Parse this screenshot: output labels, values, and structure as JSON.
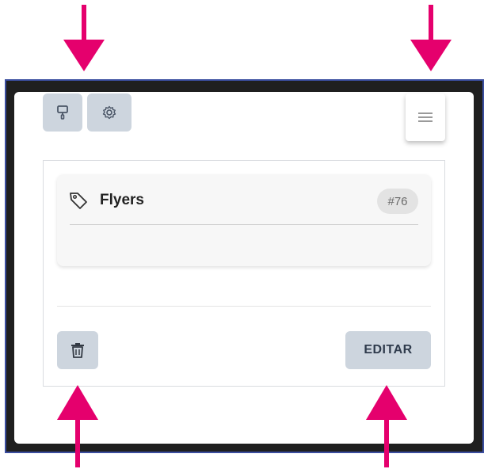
{
  "toolbar": {
    "left_icons": [
      "paint-roller-icon",
      "gear-icon"
    ],
    "menu_icon": "hamburger-menu-icon"
  },
  "tag": {
    "icon": "tag-icon",
    "name": "Flyers",
    "id_badge": "#76"
  },
  "actions": {
    "delete_icon": "trash-icon",
    "edit_label": "EDITAR"
  },
  "annotation": {
    "arrow_color": "#e5006d",
    "arrows": [
      "down-left",
      "down-right",
      "up-left",
      "up-right"
    ]
  },
  "colors": {
    "button_bg": "#cdd5de",
    "frame_border": "#3b4ea0",
    "edit_text": "#2f3b4c"
  }
}
